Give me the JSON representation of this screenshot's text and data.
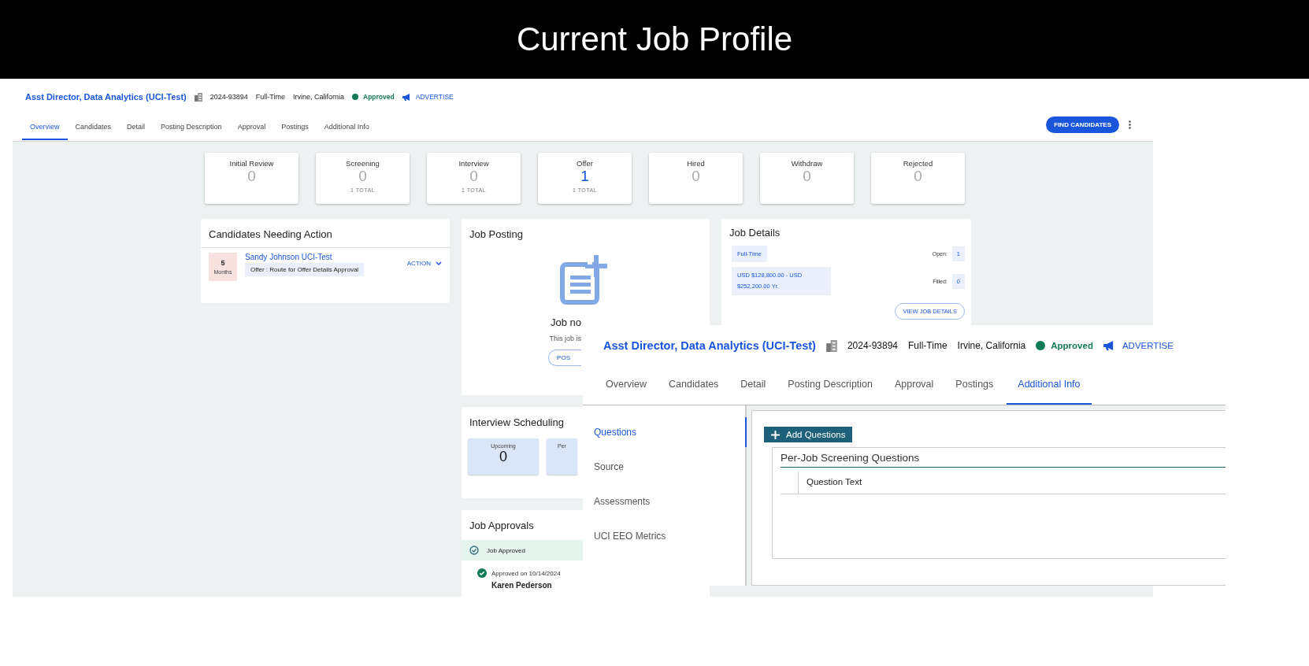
{
  "slide": {
    "title": "Current Job Profile"
  },
  "background_screen": {
    "job": {
      "title": "Asst Director, Data Analytics (UCI-Test)",
      "code": "2024-93894",
      "type": "Full-Time",
      "location": "Irvine, California",
      "status": "Approved",
      "advertise": "ADVERTISE"
    },
    "tabs": [
      {
        "label": "Overview",
        "selected": true
      },
      {
        "label": "Candidates",
        "selected": false
      },
      {
        "label": "Detail",
        "selected": false
      },
      {
        "label": "Posting Description",
        "selected": false
      },
      {
        "label": "Approval",
        "selected": false
      },
      {
        "label": "Postings",
        "selected": false
      },
      {
        "label": "Additional Info",
        "selected": false
      }
    ],
    "find_button": "FIND CANDIDATES",
    "stages": [
      {
        "label": "Initial Review",
        "count": "0",
        "highlighted": false
      },
      {
        "label": "Screening",
        "count": "0",
        "total": "1 TOTAL",
        "highlighted": false
      },
      {
        "label": "Interview",
        "count": "0",
        "total": "1 TOTAL",
        "highlighted": false
      },
      {
        "label": "Offer",
        "count": "1",
        "total": "1 TOTAL",
        "highlighted": true
      },
      {
        "label": "Hired",
        "count": "0",
        "highlighted": false
      },
      {
        "label": "Withdraw",
        "count": "0",
        "highlighted": false
      },
      {
        "label": "Rejected",
        "count": "0",
        "highlighted": false
      }
    ],
    "candidates_needing_action": {
      "title": "Candidates Needing Action",
      "items": [
        {
          "duration": "5",
          "unit": "Months",
          "name": "Sandy Johnson UCI-Test",
          "status": "Offer : Route for Offer Details Approval",
          "action": "ACTION"
        }
      ]
    },
    "job_posting": {
      "title": "Job Posting",
      "heading": "Job no",
      "text": "This job is",
      "button": "POS"
    },
    "job_details": {
      "title": "Job Details",
      "type": "Full-Time",
      "salary": "USD $128,800.00 - USD $252,200.00 Yr.",
      "open_label": "Open:",
      "open": "1",
      "filled_label": "Filled:",
      "filled": "0",
      "button": "VIEW JOB DETAILS"
    },
    "interview_scheduling": {
      "title": "Interview Scheduling",
      "cards": [
        {
          "label": "Upcoming",
          "count": "0"
        },
        {
          "label": "Per"
        }
      ]
    },
    "job_approvals": {
      "title": "Job Approvals",
      "status": "Job Approved",
      "entries": [
        {
          "date": "Approved on 10/14/2024",
          "name": "Karen Pederson"
        }
      ]
    }
  },
  "overlay_screen": {
    "job": {
      "title": "Asst Director, Data Analytics (UCI-Test)",
      "code": "2024-93894",
      "type": "Full-Time",
      "location": "Irvine, California",
      "status": "Approved",
      "advertise": "ADVERTISE"
    },
    "tabs": [
      {
        "label": "Overview",
        "selected": false
      },
      {
        "label": "Candidates",
        "selected": false
      },
      {
        "label": "Detail",
        "selected": false
      },
      {
        "label": "Posting Description",
        "selected": false
      },
      {
        "label": "Approval",
        "selected": false
      },
      {
        "label": "Postings",
        "selected": false
      },
      {
        "label": "Additional Info",
        "selected": true
      }
    ],
    "sidebar": {
      "items": [
        {
          "label": "Questions",
          "selected": true
        },
        {
          "label": "Source",
          "selected": false
        },
        {
          "label": "Assessments",
          "selected": false
        },
        {
          "label": "UCI EEO Metrics",
          "selected": false
        }
      ]
    },
    "add_button": "Add Questions",
    "panel": {
      "title": "Per-Job Screening Questions",
      "columns": [
        "Question Text"
      ]
    }
  }
}
